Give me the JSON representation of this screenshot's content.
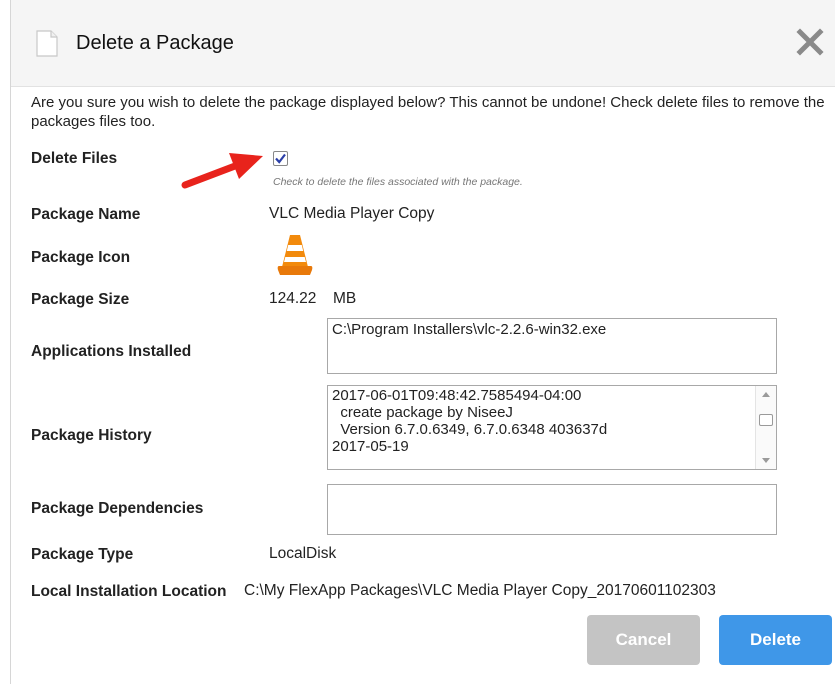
{
  "dialog": {
    "title": "Delete a Package",
    "message": "Are you sure you wish to delete the package displayed below? This cannot be undone! Check delete files to remove the packages files too.",
    "icons": {
      "document": "document-icon",
      "close": "close-icon",
      "package": "vlc-cone-icon",
      "pointer": "red-arrow-icon"
    }
  },
  "fields": {
    "delete_files": {
      "label": "Delete Files",
      "checked": true,
      "hint": "Check to delete the files associated with the package."
    },
    "package_name": {
      "label": "Package Name",
      "value": "VLC Media Player Copy"
    },
    "package_icon": {
      "label": "Package Icon"
    },
    "package_size": {
      "label": "Package Size",
      "value": "124.22",
      "unit": "MB"
    },
    "applications_installed": {
      "label": "Applications Installed",
      "value": "C:\\Program Installers\\vlc-2.2.6-win32.exe"
    },
    "package_history": {
      "label": "Package History",
      "lines": [
        "2017-06-01T09:48:42.7585494-04:00",
        "  create package by NiseeJ",
        "  Version 6.7.0.6349, 6.7.0.6348 403637d",
        "2017-05-19"
      ]
    },
    "package_dependencies": {
      "label": "Package Dependencies",
      "value": ""
    },
    "package_type": {
      "label": "Package Type",
      "value": "LocalDisk"
    },
    "local_installation_location": {
      "label": "Local Installation Location",
      "value": "C:\\My FlexApp Packages\\VLC Media Player Copy_20170601102303"
    }
  },
  "buttons": {
    "cancel": "Cancel",
    "delete": "Delete"
  },
  "colors": {
    "delete_button": "#3f97e8",
    "cancel_button": "#c4c4c4",
    "arrow": "#e8231c",
    "checkbox_check": "#2b3fa8"
  }
}
